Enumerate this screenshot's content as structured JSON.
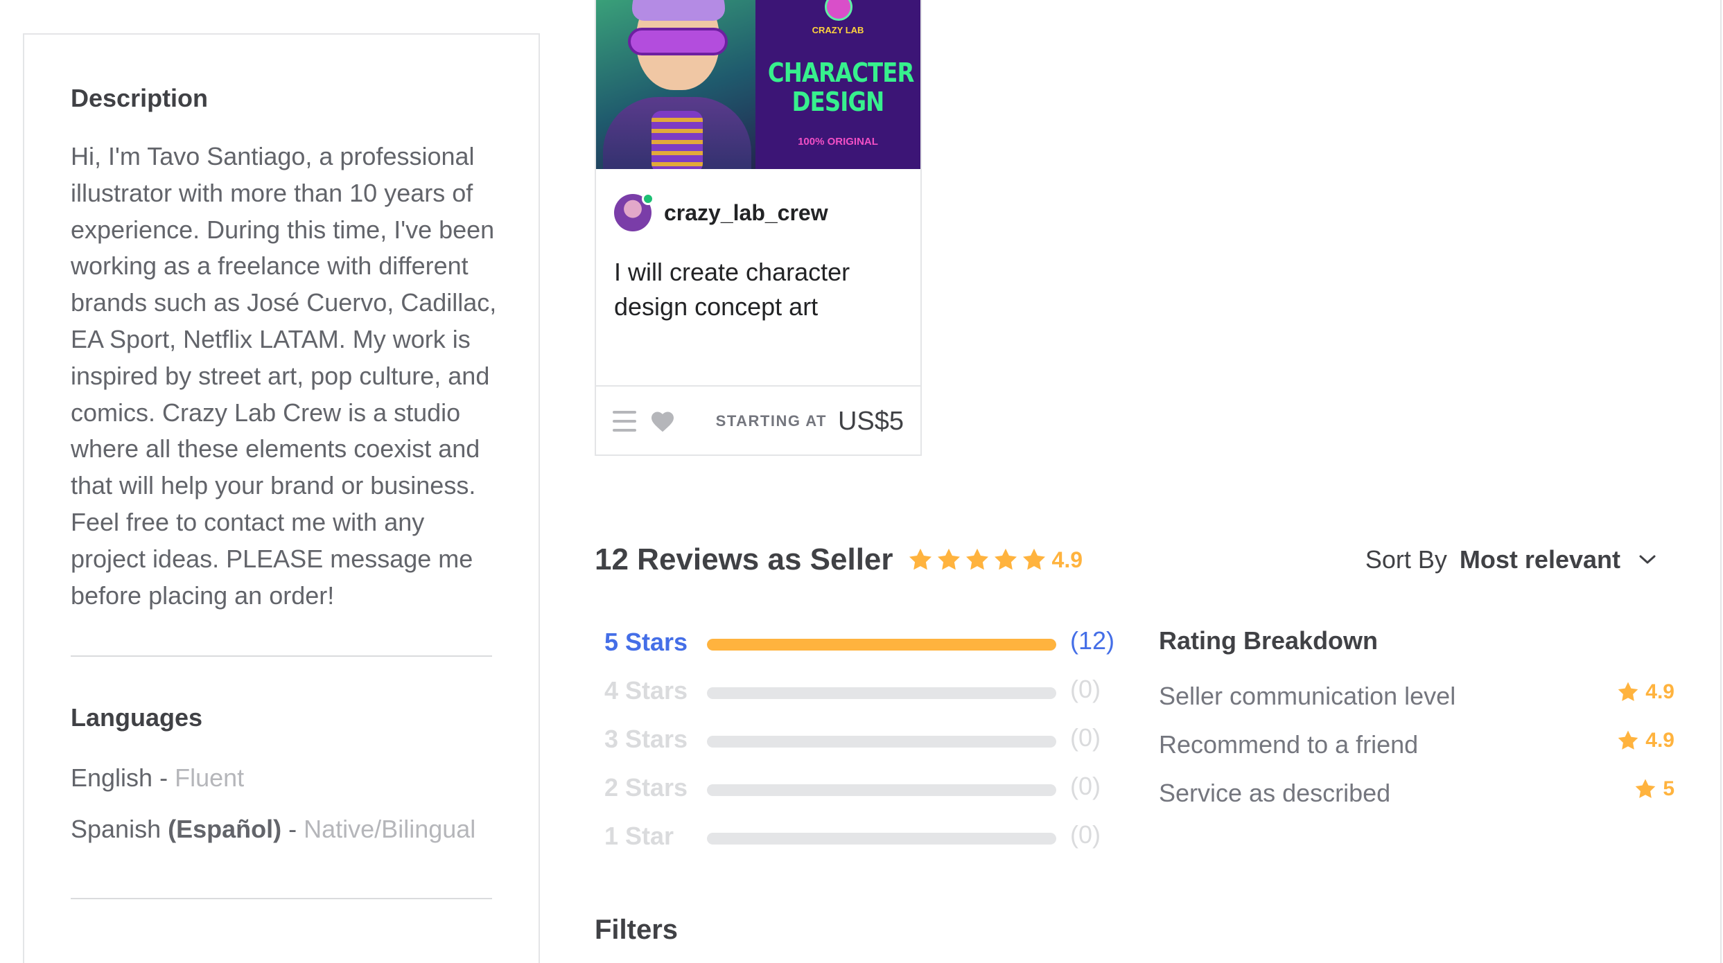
{
  "description": {
    "title": "Description",
    "text": "Hi, I'm Tavo Santiago, a professional illustrator with more than 10 years of experience. During this time, I've been working as a freelance with different brands such as José Cuervo, Cadillac, EA Sport, Netflix LATAM. My work is inspired by street art, pop culture, and comics. Crazy Lab Crew is a studio where all these elements coexist and that will help your brand or business. Feel free to contact me with any project ideas. PLEASE message me before placing an order!"
  },
  "languages": {
    "title": "Languages",
    "items": [
      {
        "name": "English",
        "native": "",
        "separator": " - ",
        "level": "Fluent"
      },
      {
        "name": "Spanish",
        "native": "(Español)",
        "separator": " - ",
        "level": "Native/Bilingual"
      }
    ]
  },
  "gig_card": {
    "image": {
      "brand": "CRAZY LAB",
      "title": "CHARACTER DESIGN",
      "subtitle": "100% ORIGINAL"
    },
    "seller_name": "crazy_lab_crew",
    "seller_online": true,
    "title": "I will create character design concept art",
    "starting_at_label": "STARTING AT",
    "price": "US$5",
    "icons": [
      "menu-icon",
      "heart-icon"
    ]
  },
  "reviews": {
    "title": "12 Reviews as Seller",
    "average": "4.9",
    "star_count": 5,
    "sort_label": "Sort By",
    "sort_value": "Most relevant",
    "star_color": "#ffb33e",
    "bars": [
      {
        "label": "5 Stars",
        "count": "(12)",
        "fraction": 1.0,
        "active": true
      },
      {
        "label": "4 Stars",
        "count": "(0)",
        "fraction": 0,
        "active": false
      },
      {
        "label": "3 Stars",
        "count": "(0)",
        "fraction": 0,
        "active": false
      },
      {
        "label": "2 Stars",
        "count": "(0)",
        "fraction": 0,
        "active": false
      },
      {
        "label": "1 Star",
        "count": "(0)",
        "fraction": 0,
        "active": false
      }
    ],
    "breakdown": {
      "title": "Rating Breakdown",
      "items": [
        {
          "label": "Seller communication level",
          "value": "4.9"
        },
        {
          "label": "Recommend to a friend",
          "value": "4.9"
        },
        {
          "label": "Service as described",
          "value": "5"
        }
      ]
    }
  },
  "filters": {
    "title": "Filters"
  }
}
